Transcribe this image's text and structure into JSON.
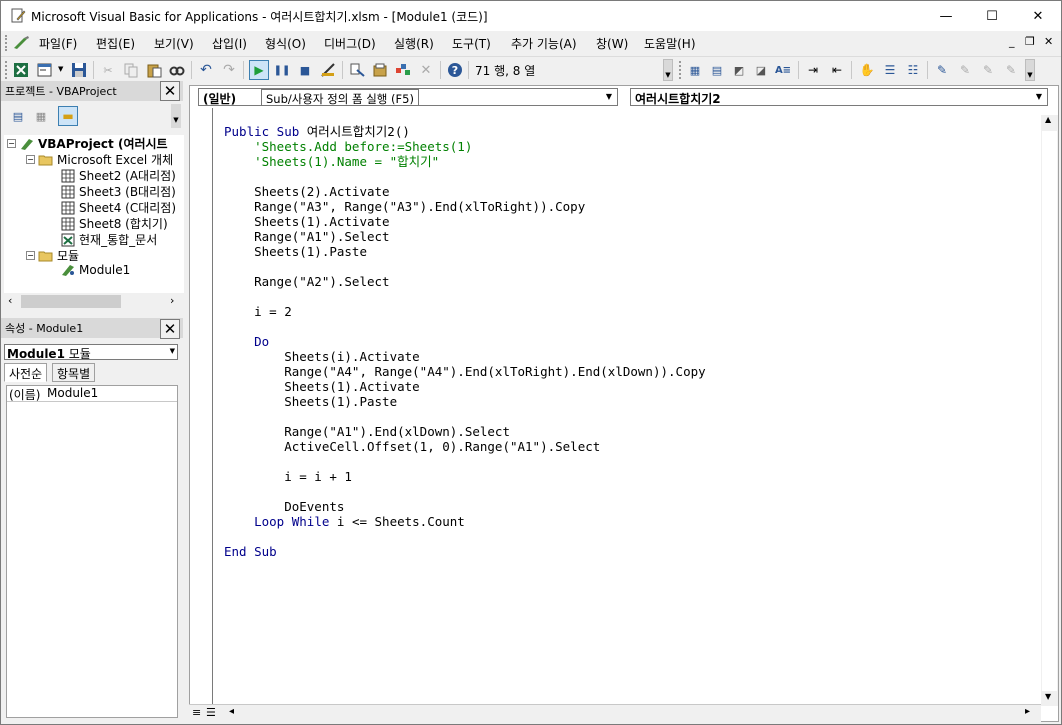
{
  "window": {
    "title": "Microsoft Visual Basic for Applications - 여러시트합치기.xlsm - [Module1 (코드)]",
    "min_label": "—",
    "max_label": "☐",
    "close_label": "✕"
  },
  "menu": {
    "items": [
      "파일(F)",
      "편집(E)",
      "보기(V)",
      "삽입(I)",
      "형식(O)",
      "디버그(D)",
      "실행(R)",
      "도구(T)",
      "추가 기능(A)",
      "창(W)",
      "도움말(H)"
    ],
    "mdi_min": "_",
    "mdi_restore": "❐",
    "mdi_close": "✕"
  },
  "toolbar": {
    "position": "71 행, 8 열",
    "tooltip": "Sub/사용자 정의 폼 실행 (F5)",
    "icons": [
      "excel-view-icon",
      "insert-userform-icon",
      "save-icon",
      "cut-icon",
      "copy-icon",
      "paste-icon",
      "find-icon",
      "undo-icon",
      "redo-icon",
      "run-icon",
      "break-icon",
      "reset-icon",
      "design-mode-icon",
      "project-explorer-icon",
      "properties-icon",
      "object-browser-icon",
      "toolbox-icon",
      "help-icon"
    ]
  },
  "project_pane": {
    "title": "프로젝트 - VBAProject",
    "close": "✕",
    "tree": {
      "root": "VBAProject (여러시트",
      "excel_objects_folder": "Microsoft Excel 개체",
      "sheets": [
        "Sheet2 (A대리점)",
        "Sheet3 (B대리점)",
        "Sheet4 (C대리점)",
        "Sheet8 (합치기)"
      ],
      "workbook": "현재_통합_문서",
      "modules_folder": "모듈",
      "module": "Module1"
    }
  },
  "properties_pane": {
    "title": "속성 - Module1",
    "close": "✕",
    "object_select_name": "Module1",
    "object_select_type": "모듈",
    "tabs": [
      "사전순",
      "항목별"
    ],
    "rows": [
      {
        "name": "(이름)",
        "value": "Module1"
      }
    ]
  },
  "code_window": {
    "object_combo": "(일반)",
    "proc_combo": "여러시트합치기2",
    "code_lines": [
      [
        {
          "t": "Public Sub",
          "c": "kw"
        },
        {
          "t": " 여러시트합치기2()",
          "c": ""
        }
      ],
      [
        {
          "t": "    'Sheets.Add before:=Sheets(1)",
          "c": "cm"
        }
      ],
      [
        {
          "t": "    'Sheets(1).Name = \"합치기\"",
          "c": "cm"
        }
      ],
      [],
      [
        {
          "t": "    Sheets(2).Activate",
          "c": ""
        }
      ],
      [
        {
          "t": "    Range(\"A3\", Range(\"A3\").End(xlToRight)).Copy",
          "c": ""
        }
      ],
      [
        {
          "t": "    Sheets(1).Activate",
          "c": ""
        }
      ],
      [
        {
          "t": "    Range(\"A1\").Select",
          "c": ""
        }
      ],
      [
        {
          "t": "    Sheets(1).Paste",
          "c": ""
        }
      ],
      [],
      [
        {
          "t": "    Range(\"A2\").Select",
          "c": ""
        }
      ],
      [],
      [
        {
          "t": "    i = 2",
          "c": ""
        }
      ],
      [],
      [
        {
          "t": "    ",
          "c": ""
        },
        {
          "t": "Do",
          "c": "kw"
        }
      ],
      [
        {
          "t": "        Sheets(i).Activate",
          "c": ""
        }
      ],
      [
        {
          "t": "        Range(\"A4\", Range(\"A4\").End(xlToRight).End(xlDown)).Copy",
          "c": ""
        }
      ],
      [
        {
          "t": "        Sheets(1).Activate",
          "c": ""
        }
      ],
      [
        {
          "t": "        Sheets(1).Paste",
          "c": ""
        }
      ],
      [],
      [
        {
          "t": "        Range(\"A1\").End(xlDown).Select",
          "c": ""
        }
      ],
      [
        {
          "t": "        ActiveCell.Offset(1, 0).Range(\"A1\").Select",
          "c": ""
        }
      ],
      [],
      [
        {
          "t": "        i = i + 1",
          "c": ""
        }
      ],
      [],
      [
        {
          "t": "        DoEvents",
          "c": ""
        }
      ],
      [
        {
          "t": "    ",
          "c": ""
        },
        {
          "t": "Loop While",
          "c": "kw"
        },
        {
          "t": " i <= Sheets.Count",
          "c": ""
        }
      ],
      [],
      [
        {
          "t": "End Sub",
          "c": "kw"
        }
      ]
    ]
  },
  "colors": {
    "keyword": "#00008b",
    "comment": "#008000",
    "pane_title_bg": "#d9d9d9",
    "active_button_border": "#3c7fb1"
  }
}
